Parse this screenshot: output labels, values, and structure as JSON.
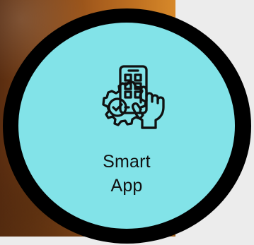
{
  "card": {
    "title_lines": [
      "Smart",
      "App"
    ],
    "icon": "smart-app-phone-gear-touch-icon",
    "colors": {
      "circle_fill": "#82e3e8",
      "ring": "#000000",
      "photo_warm": "#bf7121",
      "background": "#ececec"
    }
  }
}
